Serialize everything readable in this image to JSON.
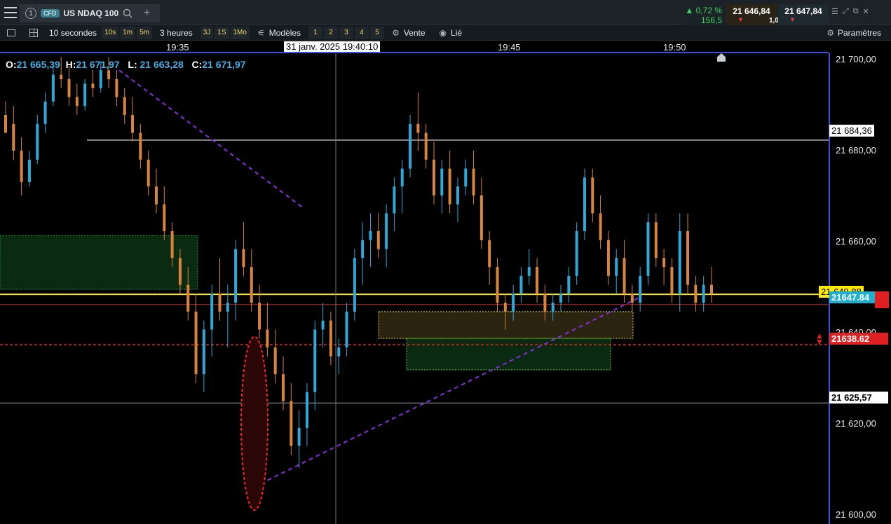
{
  "toolbar": {
    "tab_number": "1",
    "tab_type": "CFD",
    "symbol": "US NDAQ 100",
    "add": "+",
    "change_pct": "▲ 0,72 %",
    "change_pts": "156,5",
    "bid": "21 646,84",
    "ask": "21 647,84",
    "spread": "1,00"
  },
  "bar2": {
    "interval": "10 secondes",
    "s10": "10s",
    "m1": "1m",
    "m5": "5m",
    "range": "3 heures",
    "r3j": "3J",
    "r1s": "1S",
    "r1mo": "1Mo",
    "modeles": "Modèles",
    "slots": [
      "1",
      "2",
      "3",
      "4",
      "5"
    ],
    "vente": "Vente",
    "lie": "Lié",
    "parametres": "Paramètres"
  },
  "xaxis": {
    "labels": [
      "19:35",
      "19:45",
      "19:50"
    ],
    "cursor_time": "31 janv. 2025 19:40:10"
  },
  "ohlc": {
    "o": "21 665,39",
    "h": "21 671,97",
    "l": "21 663,28",
    "c": "21 671,97"
  },
  "yaxis": {
    "labels": [
      "21 700,00",
      "21 680,00",
      "21 660,00",
      "21 640,00",
      "21 620,00",
      "21 600,00"
    ]
  },
  "tags": {
    "hline1": "21 684,36",
    "yellow": "21 649,88",
    "current": "21647.84",
    "red": "21638.62",
    "hline2": "21 625,57"
  },
  "chart_data": {
    "type": "candlestick",
    "ylim": [
      21598.5,
      21703.8
    ],
    "y_ticks": [
      21700,
      21680,
      21660,
      21640,
      21620,
      21600
    ],
    "x_ticks": [
      "19:35",
      "19:45",
      "19:50"
    ],
    "candle_colors": {
      "up": "#2fa8d8",
      "down": "#d8843a"
    },
    "candles": [
      [
        21690,
        21693,
        21688,
        21686
      ],
      [
        21688,
        21692,
        21680,
        21682
      ],
      [
        21682,
        21685,
        21672,
        21675
      ],
      [
        21675,
        21682,
        21674,
        21680
      ],
      [
        21680,
        21690,
        21679,
        21688
      ],
      [
        21688,
        21695,
        21686,
        21693
      ],
      [
        21693,
        21701,
        21692,
        21699
      ],
      [
        21699,
        21703,
        21696,
        21698
      ],
      [
        21698,
        21701,
        21692,
        21694
      ],
      [
        21694,
        21697,
        21690,
        21692
      ],
      [
        21692,
        21698,
        21691,
        21697
      ],
      [
        21697,
        21700,
        21694,
        21696
      ],
      [
        21696,
        21702,
        21695,
        21700
      ],
      [
        21700,
        21703,
        21696,
        21698
      ],
      [
        21698,
        21700,
        21692,
        21694
      ],
      [
        21694,
        21696,
        21688,
        21690
      ],
      [
        21690,
        21694,
        21684,
        21686
      ],
      [
        21686,
        21688,
        21678,
        21680
      ],
      [
        21680,
        21682,
        21672,
        21674
      ],
      [
        21674,
        21678,
        21668,
        21670
      ],
      [
        21670,
        21674,
        21662,
        21664
      ],
      [
        21664,
        21666,
        21656,
        21658
      ],
      [
        21658,
        21660,
        21650,
        21652
      ],
      [
        21652,
        21656,
        21644,
        21646
      ],
      [
        21646,
        21650,
        21630,
        21632
      ],
      [
        21632,
        21644,
        21628,
        21642
      ],
      [
        21642,
        21652,
        21636,
        21650
      ],
      [
        21650,
        21658,
        21644,
        21646
      ],
      [
        21646,
        21652,
        21638,
        21648
      ],
      [
        21648,
        21662,
        21644,
        21660
      ],
      [
        21660,
        21666,
        21654,
        21656
      ],
      [
        21656,
        21660,
        21646,
        21648
      ],
      [
        21648,
        21652,
        21640,
        21642
      ],
      [
        21642,
        21648,
        21636,
        21638
      ],
      [
        21638,
        21642,
        21630,
        21632
      ],
      [
        21632,
        21636,
        21624,
        21626
      ],
      [
        21626,
        21630,
        21614,
        21616
      ],
      [
        21616,
        21624,
        21611,
        21620
      ],
      [
        21620,
        21630,
        21616,
        21628
      ],
      [
        21628,
        21644,
        21624,
        21642
      ],
      [
        21642,
        21648,
        21638,
        21644
      ],
      [
        21644,
        21646,
        21634,
        21636
      ],
      [
        21636,
        21640,
        21632,
        21638
      ],
      [
        21638,
        21648,
        21636,
        21646
      ],
      [
        21646,
        21660,
        21644,
        21658
      ],
      [
        21658,
        21666,
        21652,
        21662
      ],
      [
        21662,
        21668,
        21656,
        21664
      ],
      [
        21664,
        21668,
        21658,
        21660
      ],
      [
        21660,
        21670,
        21656,
        21668
      ],
      [
        21668,
        21676,
        21664,
        21674
      ],
      [
        21674,
        21680,
        21668,
        21678
      ],
      [
        21678,
        21690,
        21676,
        21688
      ],
      [
        21688,
        21695,
        21682,
        21686
      ],
      [
        21686,
        21688,
        21678,
        21680
      ],
      [
        21680,
        21684,
        21670,
        21672
      ],
      [
        21672,
        21680,
        21668,
        21678
      ],
      [
        21678,
        21682,
        21668,
        21670
      ],
      [
        21670,
        21676,
        21666,
        21674
      ],
      [
        21674,
        21680,
        21672,
        21678
      ],
      [
        21678,
        21682,
        21670,
        21672
      ],
      [
        21672,
        21676,
        21660,
        21662
      ],
      [
        21662,
        21664,
        21652,
        21656
      ],
      [
        21656,
        21658,
        21646,
        21648
      ],
      [
        21648,
        21650,
        21642,
        21646
      ],
      [
        21646,
        21652,
        21644,
        21650
      ],
      [
        21650,
        21656,
        21648,
        21654
      ],
      [
        21654,
        21660,
        21652,
        21656
      ],
      [
        21656,
        21658,
        21648,
        21650
      ],
      [
        21650,
        21652,
        21644,
        21646
      ],
      [
        21646,
        21650,
        21644,
        21648
      ],
      [
        21648,
        21652,
        21646,
        21650
      ],
      [
        21650,
        21656,
        21648,
        21654
      ],
      [
        21654,
        21666,
        21652,
        21664
      ],
      [
        21664,
        21678,
        21662,
        21676
      ],
      [
        21676,
        21678,
        21666,
        21668
      ],
      [
        21668,
        21672,
        21660,
        21662
      ],
      [
        21662,
        21664,
        21652,
        21654
      ],
      [
        21654,
        21660,
        21650,
        21658
      ],
      [
        21658,
        21662,
        21648,
        21650
      ],
      [
        21650,
        21652,
        21646,
        21648
      ],
      [
        21648,
        21656,
        21646,
        21654
      ],
      [
        21654,
        21668,
        21652,
        21666
      ],
      [
        21666,
        21668,
        21656,
        21658
      ],
      [
        21658,
        21660,
        21652,
        21656
      ],
      [
        21656,
        21658,
        21648,
        21650
      ],
      [
        21650,
        21668,
        21646,
        21664
      ],
      [
        21664,
        21668,
        21650,
        21652
      ],
      [
        21652,
        21654,
        21646,
        21648
      ],
      [
        21648,
        21654,
        21646,
        21652
      ],
      [
        21652,
        21656,
        21648,
        21650
      ]
    ],
    "annotations": [
      "Fibonacci/trend lines (dashed purple)",
      "Support/resistance zones (dotted green/yellow boxes)",
      "Red dashed ellipse at low"
    ]
  },
  "colors": {
    "accent": "#3b4fd8",
    "up": "#2fa8d8",
    "down": "#d8843a",
    "yellow_line": "#ffea00",
    "red_line": "#e02020"
  }
}
